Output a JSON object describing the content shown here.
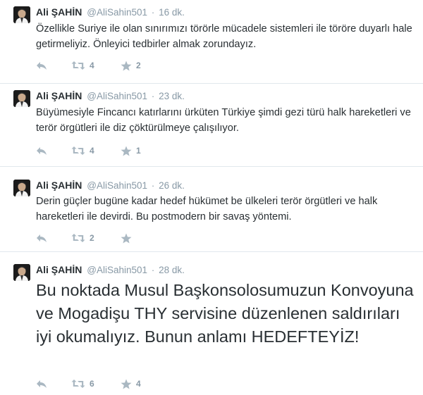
{
  "tweets": [
    {
      "fullname": "Ali ŞAHİN",
      "username": "@AliSahin501",
      "separator": "·",
      "time": "16 dk.",
      "text": "Özellikle Suriye ile olan sınırımızı törörle mücadele sistemleri ile töröre duyarlı hale getirmeliyiz. Önleyici tedbirler almak zorundayız.",
      "retweets": "4",
      "favorites": "2"
    },
    {
      "fullname": "Ali ŞAHİN",
      "username": "@AliSahin501",
      "separator": "·",
      "time": "23 dk.",
      "text": "Büyümesiyle Fincancı katırlarını ürküten Türkiye şimdi gezi türü halk hareketleri ve terör örgütleri ile diz çöktürülmeye çalışılıyor.",
      "retweets": "4",
      "favorites": "1"
    },
    {
      "fullname": "Ali ŞAHİN",
      "username": "@AliSahin501",
      "separator": "·",
      "time": "26 dk.",
      "text": "Derin güçler bugüne kadar hedef hükümet be ülkeleri terör örgütleri ve halk hareketleri ile devirdi. Bu postmodern bir savaş yöntemi.",
      "retweets": "2",
      "favorites": ""
    },
    {
      "fullname": "Ali ŞAHİN",
      "username": "@AliSahin501",
      "separator": "·",
      "time": "28 dk.",
      "text": "Bu noktada Musul Başkonsolosumuzun Konvoyuna ve Mogadişu THY servisine düzenlenen saldırıları iyi okumalıyız. Bunun anlamı HEDEFTEYİZ!",
      "retweets": "6",
      "favorites": "4"
    }
  ],
  "icons": {
    "reply": "reply-icon",
    "retweet": "retweet-icon",
    "favorite": "star-icon"
  },
  "colors": {
    "text": "#292f33",
    "muted": "#8899a6",
    "icon": "#aab8c2",
    "divider": "#e1e8ed"
  }
}
